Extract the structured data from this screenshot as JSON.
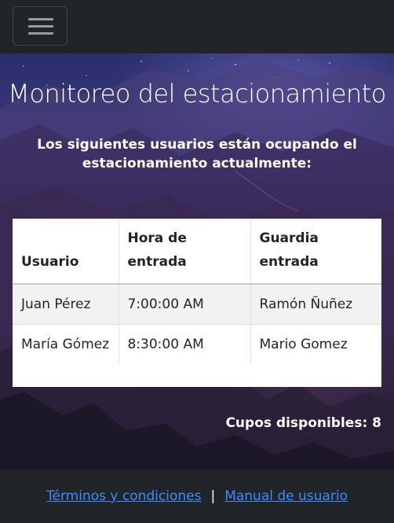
{
  "navbar": {
    "toggle_icon": "hamburger-menu-icon"
  },
  "hero": {
    "title": "Monitoreo del estacionamiento",
    "subtitle": "Los siguientes usuarios están ocupando el estacionamiento actualmente:"
  },
  "table": {
    "headers": [
      "Usuario",
      "Hora de entrada",
      "Guardia entrada"
    ],
    "rows": [
      [
        "Juan Pérez",
        "7:00:00 AM",
        "Ramón Ñuñez"
      ],
      [
        "María Gómez",
        "8:30:00 AM",
        "Mario Gomez"
      ]
    ]
  },
  "cupos": "Cupos disponibles: 8",
  "footer": {
    "terms": "Términos y condiciones",
    "separator": "|",
    "manual": "Manual de usuario"
  }
}
